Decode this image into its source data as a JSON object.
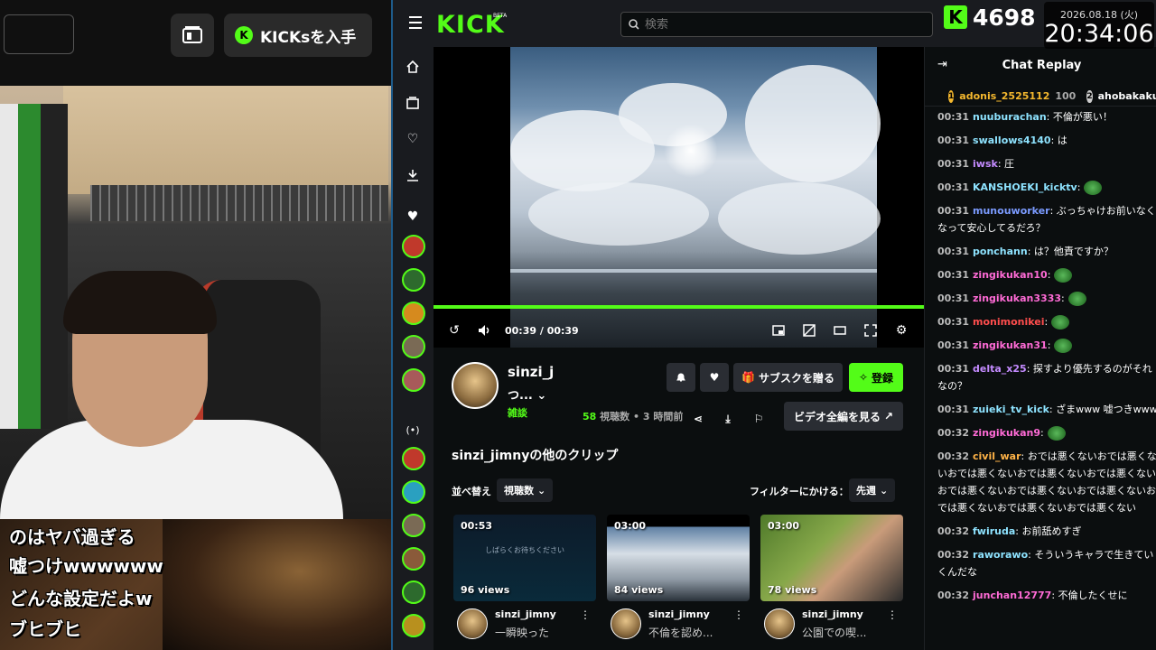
{
  "left_panel": {
    "kicks_button": "KICKsを入手",
    "captions": [
      "のはヤバ過ぎる",
      "嘘つけwwwwww",
      "どんな設定だよw",
      "ブヒブヒ"
    ]
  },
  "overlay": {
    "kick_count": "4698",
    "date": "2026.08.18 (火)",
    "time": "20:34:06"
  },
  "app": {
    "logo": "KICK",
    "logo_beta": "BETA",
    "search_placeholder": "検索",
    "accent": "#53fc18"
  },
  "player": {
    "time_display": "00:39 / 00:39",
    "progress": 1.0
  },
  "channel": {
    "name": "sinzi_j",
    "title": "つ...",
    "category": "雑談",
    "views_count": "58",
    "views_label": "視聴数",
    "time_ago": "• 3 時間前",
    "subscribe_gift": "サブスクを贈る",
    "follow": "登録",
    "all_videos": "ビデオ全編を見る"
  },
  "clips": {
    "title": "sinzi_jimnyの他のクリップ",
    "sort_label": "並べ替え",
    "sort_value": "視聴数",
    "filter_label": "フィルターにかける：",
    "filter_value": "先週",
    "items": [
      {
        "duration": "00:53",
        "views": "96 views",
        "channel": "sinzi_jimny",
        "title": "一瞬映った"
      },
      {
        "duration": "03:00",
        "views": "84 views",
        "channel": "sinzi_jimny",
        "title": "不倫を認め..."
      },
      {
        "duration": "03:00",
        "views": "78 views",
        "channel": "sinzi_jimny",
        "title": "公園での喫..."
      }
    ],
    "clip1_screen_text": "しばらくお待ちください"
  },
  "chat": {
    "title": "Chat Replay",
    "gifters": [
      {
        "rank": "1",
        "name": "adonis_2525112",
        "count": "100"
      },
      {
        "rank": "2",
        "name": "ahobakakuzu",
        "count": ""
      }
    ],
    "messages": [
      {
        "time": "00:31",
        "user": "nuuburachan",
        "color": "#8ee3ff",
        "text": ": 不倫が悪い！"
      },
      {
        "time": "00:31",
        "user": "swallows4140",
        "color": "#8ee3ff",
        "text": ": は"
      },
      {
        "time": "00:31",
        "user": "iwsk",
        "color": "#c48bff",
        "text": ": 圧"
      },
      {
        "time": "00:31",
        "user": "KANSHOEKI_kicktv",
        "color": "#8ee3ff",
        "text": ":"
      },
      {
        "time": "00:31",
        "user": "munouworker",
        "color": "#7b9bff",
        "text": ": ぶっちゃけお前いなくなって安心してるだろ？"
      },
      {
        "time": "00:31",
        "user": "ponchann",
        "color": "#8ee3ff",
        "text": ": は？他責ですか？"
      },
      {
        "time": "00:31",
        "user": "zingikukan10",
        "color": "#ff6bd6",
        "text": ":"
      },
      {
        "time": "00:31",
        "user": "zingikukan3333",
        "color": "#ff6bd6",
        "text": ":"
      },
      {
        "time": "00:31",
        "user": "monimonikei",
        "color": "#ff4d4d",
        "text": ":"
      },
      {
        "time": "00:31",
        "user": "zingikukan31",
        "color": "#ff6bd6",
        "text": ":"
      },
      {
        "time": "00:31",
        "user": "delta_x25",
        "color": "#c48bff",
        "text": ": 探すより優先するのがそれなの？"
      },
      {
        "time": "00:31",
        "user": "zuieki_tv_kick",
        "color": "#8ee3ff",
        "text": ": ざまwww 嘘つきwww"
      },
      {
        "time": "00:32",
        "user": "zingikukan9",
        "color": "#ff6bd6",
        "text": ":"
      },
      {
        "time": "00:32",
        "user": "civil_war",
        "color": "#ffb347",
        "text": ": おでは悪くないおでは悪くないおでは悪くないおでは悪くないおでは悪くないおでは悪くないおでは悪くないおでは悪くないおでは悪くないおでは悪くないおでは悪くない"
      },
      {
        "time": "00:32",
        "user": "fwiruda",
        "color": "#8ee3ff",
        "text": ": お前舐めすぎ"
      },
      {
        "time": "00:32",
        "user": "raworаwo",
        "color": "#8ee3ff",
        "text": ": そういうキャラで生きていくんだな"
      },
      {
        "time": "00:32",
        "user": "junchan12777",
        "color": "#ff6bd6",
        "text": ": 不倫したくせに"
      }
    ]
  }
}
